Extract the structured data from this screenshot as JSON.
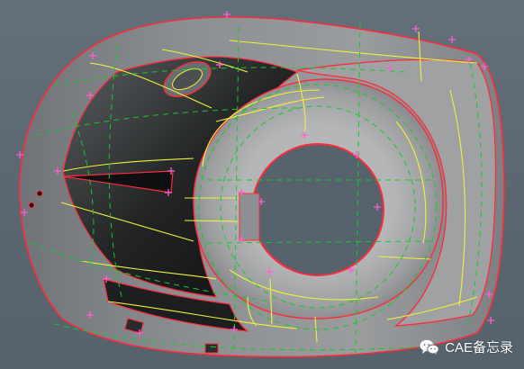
{
  "watermark": {
    "icon": "wechat-icon",
    "text": "CAE备忘录"
  },
  "colors": {
    "background": "#5e6a74",
    "surface": "#8e9194",
    "feature_edge": "#ff2a3c",
    "shared_edge": "#f0f23a",
    "interior_curve": "#18c82a",
    "vertex_marker": "#ff5fd2"
  }
}
